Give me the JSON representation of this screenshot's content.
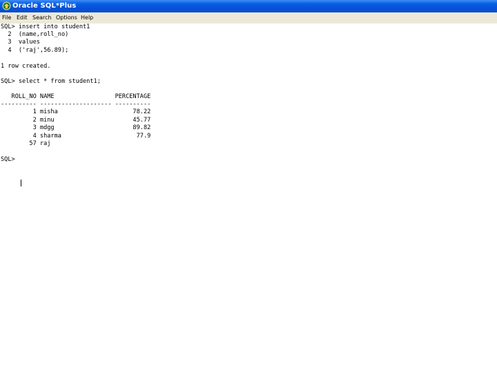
{
  "window": {
    "title": "Oracle SQL*Plus"
  },
  "menu": [
    "File",
    "Edit",
    "Search",
    "Options",
    "Help"
  ],
  "console": {
    "lines": [
      "SQL> insert into student1",
      "  2  (name,roll_no)",
      "  3  values",
      "  4  ('raj',56.89);",
      "",
      "1 row created.",
      "",
      "SQL> select * from student1;",
      "",
      "   ROLL_NO NAME                 PERCENTAGE",
      "---------- -------------------- ----------",
      "         1 misha                     78.22",
      "         2 minu                      45.77",
      "         3 mdgg                      89.82",
      "         4 sharma                     77.9",
      "        57 raj",
      "",
      "SQL> "
    ]
  }
}
